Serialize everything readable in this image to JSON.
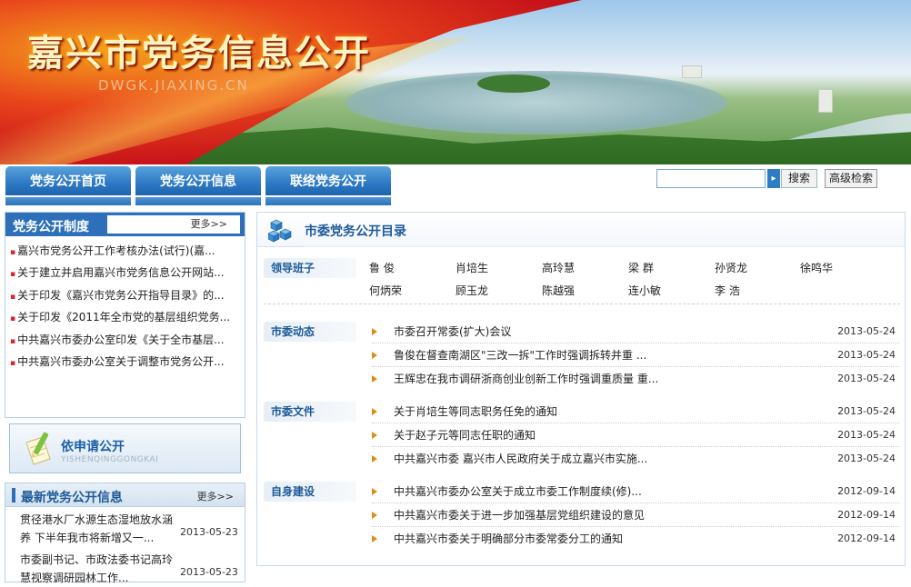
{
  "banner": {
    "title": "嘉兴市党务信息公开",
    "domain": "DWGK.JIAXING.CN"
  },
  "nav": {
    "tabs": [
      {
        "label": "党务公开首页"
      },
      {
        "label": "党务公开信息"
      },
      {
        "label": "联络党务公开"
      }
    ]
  },
  "search": {
    "placeholder": "",
    "go_icon": "▸",
    "button_label": "搜索",
    "advanced_label": "高级检索"
  },
  "sidebar": {
    "system": {
      "title": "党务公开制度",
      "more": "更多>>",
      "items": [
        "嘉兴市党务公开工作考核办法(试行)(嘉...",
        "关于建立并启用嘉兴市党务信息公开网站...",
        "关于印发《嘉兴市党务公开指导目录》的...",
        "关于印发《2011年全市党的基层组织党务...",
        "中共嘉兴市委办公室印发《关于全市基层...",
        "中共嘉兴市委办公室关于调整市党务公开..."
      ]
    },
    "apply": {
      "title": "依申请公开",
      "subtitle": "YISHENQINGGONGKAI",
      "icon": "pen-paper-icon"
    },
    "latest": {
      "title": "最新党务公开信息",
      "more": "更多>>",
      "items": [
        {
          "text": "贯径港水厂水源生态湿地放水涵养 下半年我市将新增又一...",
          "date": "2013-05-23"
        },
        {
          "text": "市委副书记、市政法委书记高玲慧视察调研园林工作...",
          "date": "2013-05-23"
        }
      ]
    }
  },
  "main": {
    "title": "市委党务公开目录",
    "icon": "cubes-icon",
    "leaders": {
      "label": "领导班子",
      "names": [
        "鲁 俊",
        "肖培生",
        "高玲慧",
        "梁 群",
        "孙贤龙",
        "徐鸣华",
        "何炳荣",
        "顾玉龙",
        "陈越强",
        "连小敏",
        "李 浩"
      ]
    },
    "sections": [
      {
        "label": "市委动态",
        "articles": [
          {
            "title": "市委召开常委(扩大)会议",
            "date": "2013-05-24"
          },
          {
            "title": "鲁俊在督查南湖区\"三改一拆\"工作时强调拆转并重 ...",
            "date": "2013-05-24"
          },
          {
            "title": "王辉忠在我市调研浙商创业创新工作时强调重质量 重...",
            "date": "2013-05-24"
          }
        ]
      },
      {
        "label": "市委文件",
        "articles": [
          {
            "title": "关于肖培生等同志职务任免的通知",
            "date": "2013-05-24"
          },
          {
            "title": "关于赵子元等同志任职的通知",
            "date": "2013-05-24"
          },
          {
            "title": "中共嘉兴市委 嘉兴市人民政府关于成立嘉兴市实施...",
            "date": "2013-05-24"
          }
        ]
      },
      {
        "label": "自身建设",
        "articles": [
          {
            "title": "中共嘉兴市委办公室关于成立市委工作制度续(修)...",
            "date": "2012-09-14"
          },
          {
            "title": "中共嘉兴市委关于进一步加强基层党组织建设的意见",
            "date": "2012-09-14"
          },
          {
            "title": "中共嘉兴市委关于明确部分市委常委分工的通知",
            "date": "2012-09-14"
          }
        ]
      }
    ]
  }
}
